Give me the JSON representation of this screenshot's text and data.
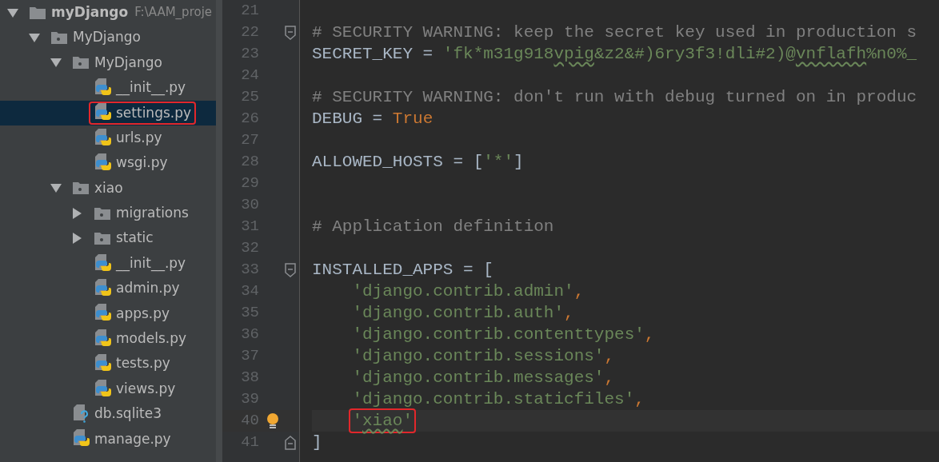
{
  "project_tree": [
    {
      "kind": "project",
      "label": "myDjango",
      "path": "F:\\AAM_proje",
      "expanded": true,
      "selected": false,
      "annotated": false,
      "children": [
        {
          "kind": "folder",
          "label": "MyDjango",
          "expanded": true,
          "selected": false,
          "annotated": false,
          "children": [
            {
              "kind": "folder",
              "label": "MyDjango",
              "expanded": true,
              "selected": false,
              "annotated": false,
              "children": [
                {
                  "kind": "python",
                  "label": "__init__.py",
                  "selected": false,
                  "annotated": false
                },
                {
                  "kind": "python",
                  "label": "settings.py",
                  "selected": true,
                  "annotated": true
                },
                {
                  "kind": "python",
                  "label": "urls.py",
                  "selected": false,
                  "annotated": false
                },
                {
                  "kind": "python",
                  "label": "wsgi.py",
                  "selected": false,
                  "annotated": false
                }
              ]
            },
            {
              "kind": "folder",
              "label": "xiao",
              "expanded": true,
              "selected": false,
              "annotated": false,
              "children": [
                {
                  "kind": "folder",
                  "label": "migrations",
                  "expanded": false,
                  "selected": false,
                  "annotated": false
                },
                {
                  "kind": "folder",
                  "label": "static",
                  "expanded": false,
                  "selected": false,
                  "annotated": false
                },
                {
                  "kind": "python",
                  "label": "__init__.py",
                  "selected": false,
                  "annotated": false
                },
                {
                  "kind": "python",
                  "label": "admin.py",
                  "selected": false,
                  "annotated": false
                },
                {
                  "kind": "python",
                  "label": "apps.py",
                  "selected": false,
                  "annotated": false
                },
                {
                  "kind": "python",
                  "label": "models.py",
                  "selected": false,
                  "annotated": false
                },
                {
                  "kind": "python",
                  "label": "tests.py",
                  "selected": false,
                  "annotated": false
                },
                {
                  "kind": "python",
                  "label": "views.py",
                  "selected": false,
                  "annotated": false
                }
              ]
            },
            {
              "kind": "unknown",
              "label": "db.sqlite3",
              "selected": false,
              "annotated": false
            },
            {
              "kind": "python",
              "label": "manage.py",
              "selected": false,
              "annotated": false
            }
          ]
        }
      ]
    }
  ],
  "editor": {
    "lines": [
      {
        "number": "21"
      },
      {
        "number": "22",
        "fold_open": true,
        "tokens": [
          {
            "kind": "comment",
            "text": "# SECURITY WARNING: keep the secret key used in production s"
          }
        ]
      },
      {
        "number": "23",
        "tokens": [
          {
            "kind": "plain",
            "text": "SECRET_KEY = "
          },
          {
            "kind": "string",
            "text": "'fk*m31g918",
            "typo": false
          },
          {
            "kind": "string",
            "text": "vpig",
            "typo": true
          },
          {
            "kind": "string",
            "text": "&z2&#)6ry3f3!dli#2)@",
            "typo": false
          },
          {
            "kind": "string",
            "text": "vnflafh",
            "typo": true
          },
          {
            "kind": "string",
            "text": "%n0%_",
            "typo": false
          }
        ]
      },
      {
        "number": "24"
      },
      {
        "number": "25",
        "tokens": [
          {
            "kind": "comment",
            "text": "# SECURITY WARNING: don't run with debug turned on in produc"
          }
        ]
      },
      {
        "number": "26",
        "tokens": [
          {
            "kind": "plain",
            "text": "DEBUG = "
          },
          {
            "kind": "keyword",
            "text": "True"
          }
        ]
      },
      {
        "number": "27"
      },
      {
        "number": "28",
        "tokens": [
          {
            "kind": "plain",
            "text": "ALLOWED_HOSTS = ["
          },
          {
            "kind": "string",
            "text": "'*'"
          },
          {
            "kind": "plain",
            "text": "]"
          }
        ]
      },
      {
        "number": "29"
      },
      {
        "number": "30"
      },
      {
        "number": "31",
        "tokens": [
          {
            "kind": "comment",
            "text": "# Application definition"
          }
        ]
      },
      {
        "number": "32"
      },
      {
        "number": "33",
        "fold_open": true,
        "tokens": [
          {
            "kind": "plain",
            "text": "INSTALLED_APPS = ["
          }
        ]
      },
      {
        "number": "34",
        "indented": true,
        "tokens": [
          {
            "kind": "string",
            "text": "'django.contrib.admin'"
          },
          {
            "kind": "keyword",
            "text": ","
          }
        ]
      },
      {
        "number": "35",
        "indented": true,
        "tokens": [
          {
            "kind": "string",
            "text": "'django.contrib.auth'"
          },
          {
            "kind": "keyword",
            "text": ","
          }
        ]
      },
      {
        "number": "36",
        "indented": true,
        "tokens": [
          {
            "kind": "string",
            "text": "'django.contrib.contenttypes'"
          },
          {
            "kind": "keyword",
            "text": ","
          }
        ]
      },
      {
        "number": "37",
        "indented": true,
        "tokens": [
          {
            "kind": "string",
            "text": "'django.contrib.sessions'"
          },
          {
            "kind": "keyword",
            "text": ","
          }
        ]
      },
      {
        "number": "38",
        "indented": true,
        "tokens": [
          {
            "kind": "string",
            "text": "'django.contrib.messages'"
          },
          {
            "kind": "keyword",
            "text": ","
          }
        ]
      },
      {
        "number": "39",
        "indented": true,
        "tokens": [
          {
            "kind": "string",
            "text": "'django.contrib.staticfiles'"
          },
          {
            "kind": "keyword",
            "text": ","
          }
        ]
      },
      {
        "number": "40",
        "indented": true,
        "current": true,
        "bulb": true,
        "annotated": true,
        "tokens": [
          {
            "kind": "string",
            "text": "'",
            "typo": false
          },
          {
            "kind": "string",
            "text": "xiao",
            "typo": true
          },
          {
            "kind": "string",
            "text": "'",
            "typo": false
          }
        ]
      },
      {
        "number": "41",
        "fold_close": true,
        "tokens": [
          {
            "kind": "plain",
            "text": "]"
          }
        ]
      }
    ]
  }
}
